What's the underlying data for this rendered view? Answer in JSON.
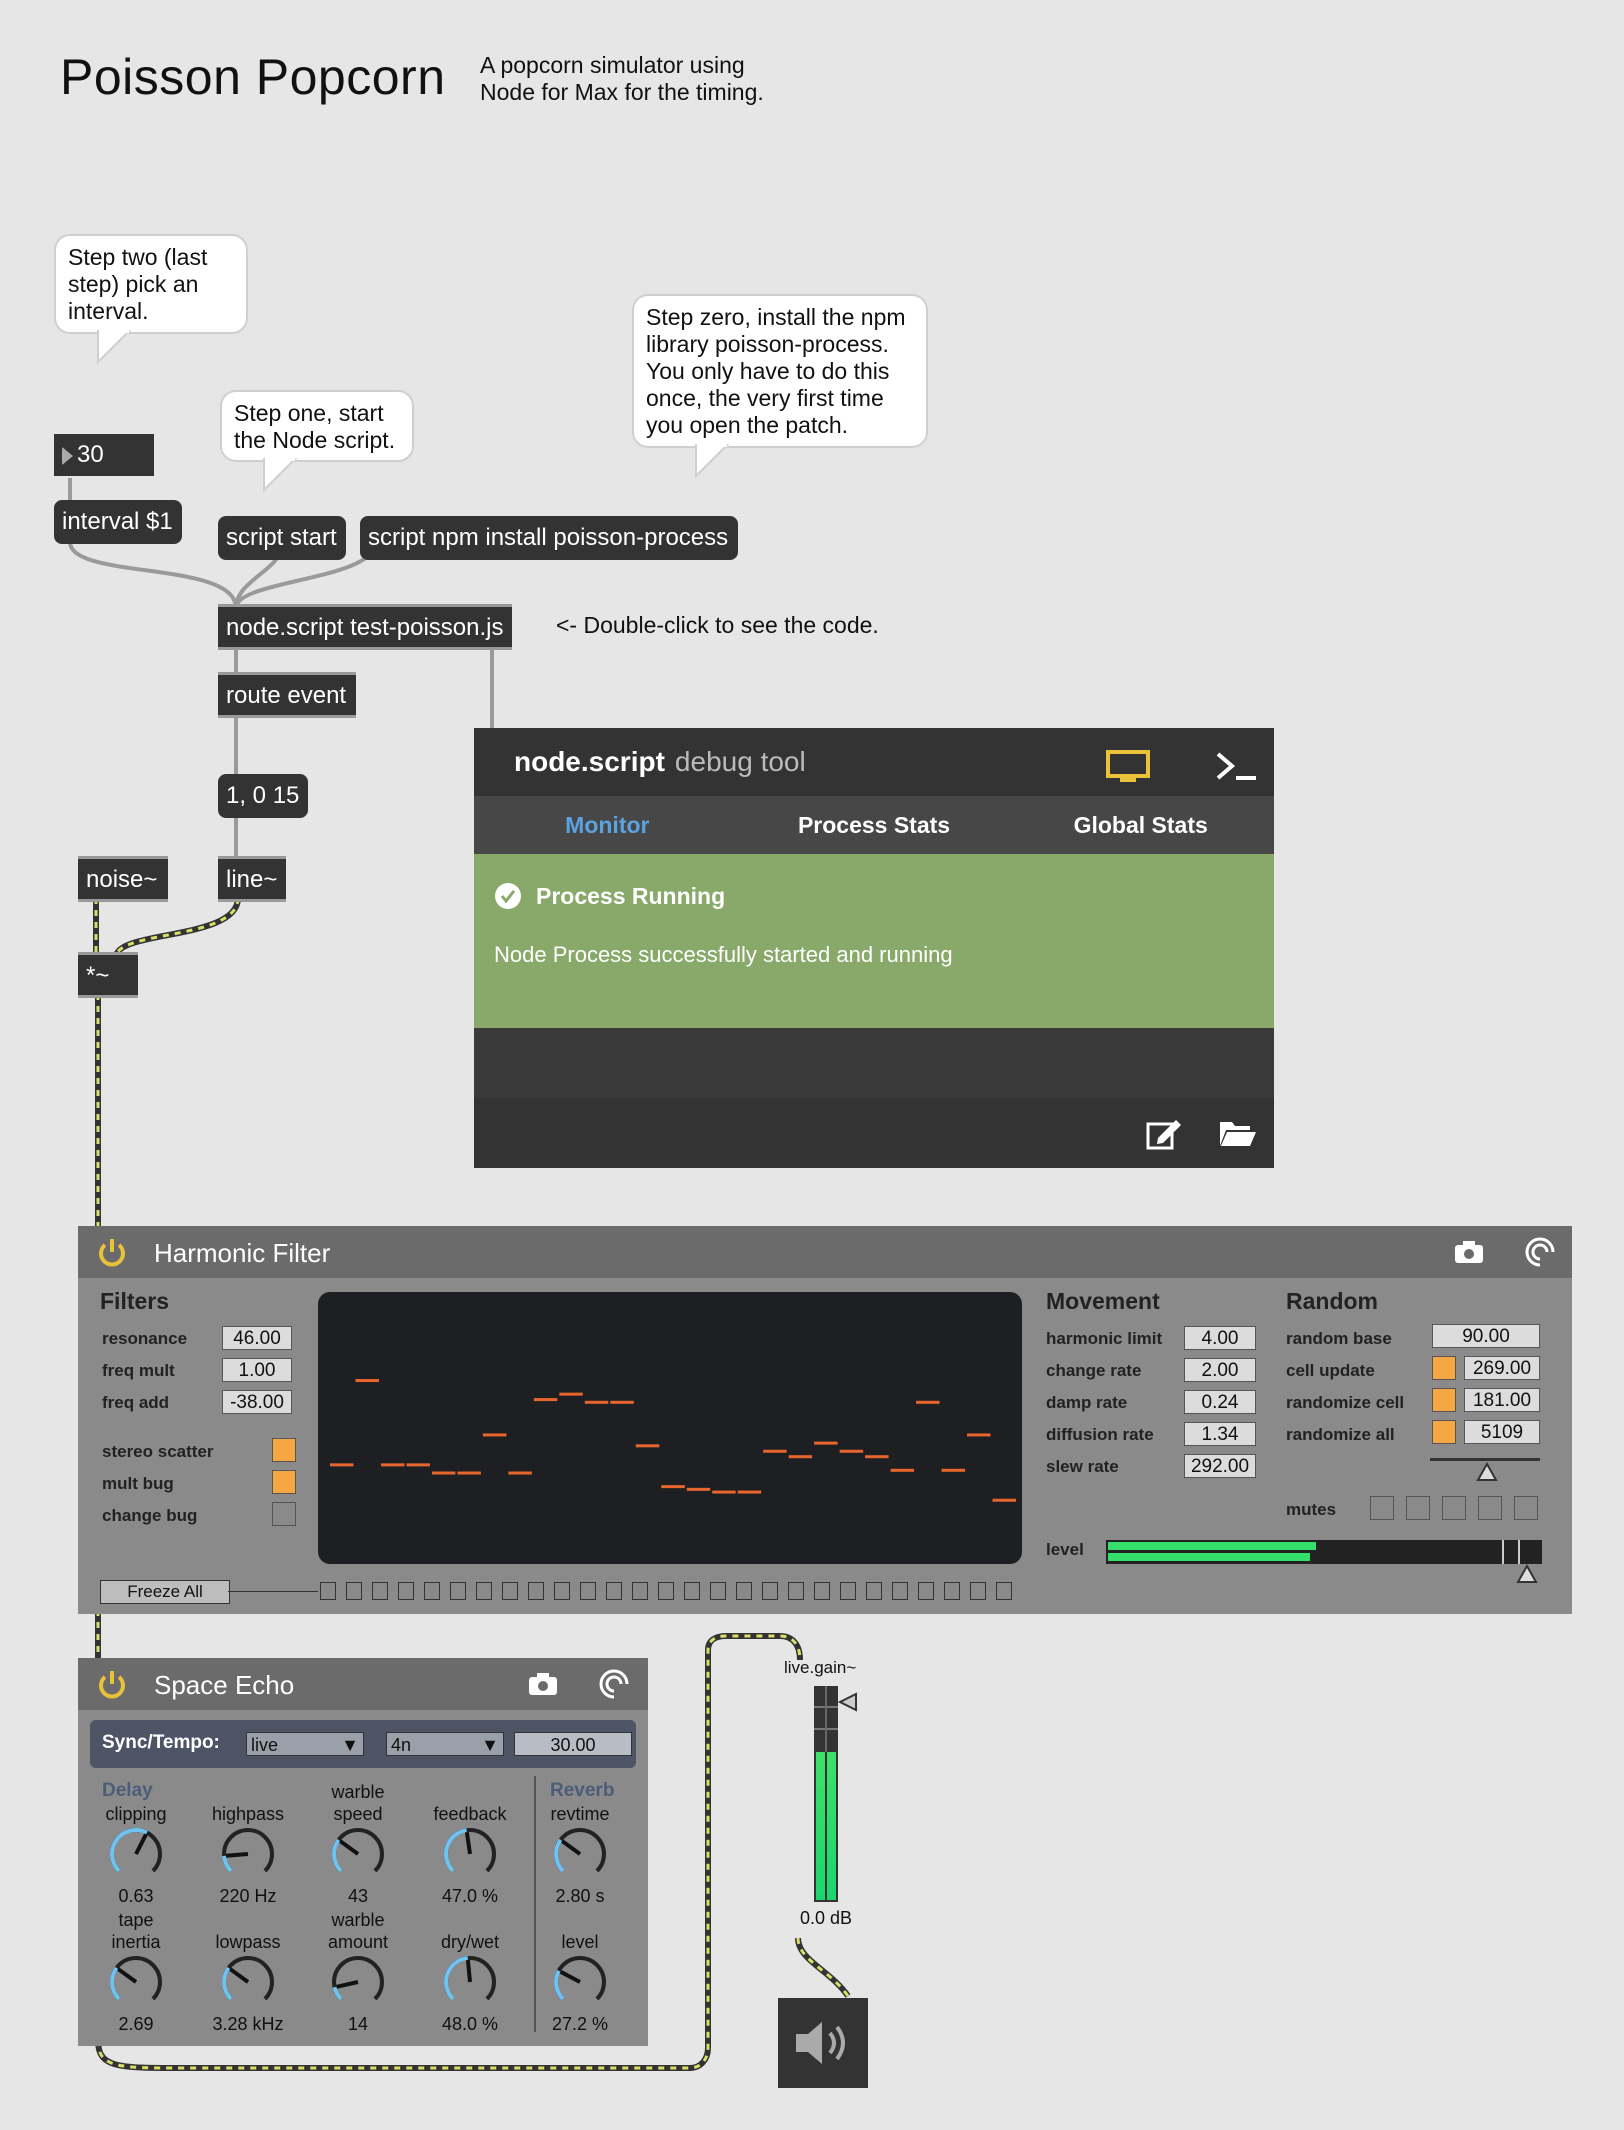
{
  "header": {
    "title": "Poisson Popcorn",
    "subtitle": "A popcorn simulator using Node for Max for the timing."
  },
  "comments": {
    "step_two": "Step two (last step) pick an interval.",
    "step_one": "Step one, start the Node script.",
    "step_zero": "Step zero, install the npm library poisson-process. You only have to do this once, the very first time you open the patch.",
    "double_click": "<- Double-click to see the code."
  },
  "objects": {
    "number_value": "30",
    "interval_msg": "interval $1",
    "script_start": "script start",
    "npm_install": "script npm install poisson-process",
    "node_script": "node.script test-poisson.js",
    "route": "route event",
    "line_msg": "1, 0 15",
    "noise": "noise~",
    "line": "line~",
    "mult": "*~",
    "live_gain": "live.gain~",
    "gain_value": "0.0 dB"
  },
  "debug_tool": {
    "name": "node.script",
    "suffix": "debug tool",
    "tabs": [
      "Monitor",
      "Process Stats",
      "Global Stats"
    ],
    "active_tab": "Monitor",
    "status_title": "Process Running",
    "status_message": "Node Process successfully started and running",
    "accent": "#5aa3e0",
    "status_color": "#88a96a"
  },
  "harmonic_filter": {
    "title": "Harmonic Filter",
    "filters_label": "Filters",
    "params": [
      {
        "label": "resonance",
        "value": "46.00"
      },
      {
        "label": "freq mult",
        "value": "1.00"
      },
      {
        "label": "freq add",
        "value": "-38.00"
      }
    ],
    "toggles": [
      {
        "label": "stereo scatter",
        "on": true
      },
      {
        "label": "mult bug",
        "on": true
      },
      {
        "label": "change bug",
        "on": false
      }
    ],
    "movement_label": "Movement",
    "movement": [
      {
        "label": "harmonic limit",
        "value": "4.00"
      },
      {
        "label": "change rate",
        "value": "2.00"
      },
      {
        "label": "damp rate",
        "value": "0.24"
      },
      {
        "label": "diffusion rate",
        "value": "1.34"
      },
      {
        "label": "slew rate",
        "value": "292.00"
      }
    ],
    "random_label": "Random",
    "random": [
      {
        "label": "random base",
        "value": "90.00"
      },
      {
        "label": "cell update",
        "value": "269.00"
      },
      {
        "label": "randomize cell",
        "value": "181.00"
      },
      {
        "label": "randomize all",
        "value": "5109"
      }
    ],
    "mutes_label": "mutes",
    "level_label": "level",
    "freeze_label": "Freeze All",
    "display_levels": [
      0.37,
      0.68,
      0.37,
      0.37,
      0.34,
      0.34,
      0.48,
      0.34,
      0.61,
      0.63,
      0.6,
      0.6,
      0.44,
      0.29,
      0.28,
      0.27,
      0.27,
      0.42,
      0.4,
      0.45,
      0.42,
      0.4,
      0.35,
      0.6,
      0.35,
      0.48,
      0.24
    ]
  },
  "space_echo": {
    "title": "Space Echo",
    "sync_label": "Sync/Tempo:",
    "sync_mode": "live",
    "note_value": "4n",
    "tempo": "30.00",
    "delay_label": "Delay",
    "reverb_label": "Reverb",
    "knobs_top": [
      {
        "label": "clipping",
        "sub": "",
        "value": "0.63",
        "pos": 0.6
      },
      {
        "label": "highpass",
        "sub": "",
        "value": "220 Hz",
        "pos": 0.15
      },
      {
        "label": "speed",
        "sub": "warble",
        "value": "43",
        "pos": 0.3
      },
      {
        "label": "feedback",
        "sub": "",
        "value": "47.0 %",
        "pos": 0.47
      },
      {
        "label": "revtime",
        "sub": "",
        "value": "2.80 s",
        "pos": 0.3
      }
    ],
    "knobs_bottom": [
      {
        "label": "inertia",
        "sub": "tape",
        "value": "2.69",
        "pos": 0.3
      },
      {
        "label": "lowpass",
        "sub": "",
        "value": "3.28 kHz",
        "pos": 0.3
      },
      {
        "label": "amount",
        "sub": "warble",
        "value": "14",
        "pos": 0.12
      },
      {
        "label": "dry/wet",
        "sub": "",
        "value": "48.0 %",
        "pos": 0.48
      },
      {
        "label": "level",
        "sub": "",
        "value": "27.2 %",
        "pos": 0.27
      }
    ]
  }
}
